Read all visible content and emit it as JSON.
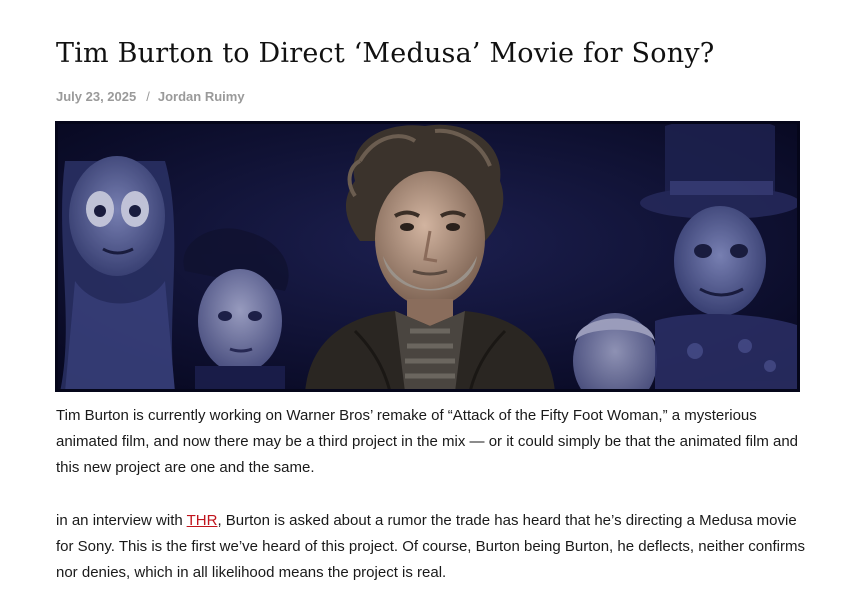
{
  "article": {
    "title": "Tim Burton to Direct ‘Medusa’ Movie for Sony?",
    "date": "July 23, 2025",
    "separator": "/",
    "author": "Jordan Ruimy",
    "hero_image": {
      "icon": "portrait-collage-image",
      "background_color": "#0b0c2a"
    },
    "paragraph1": "Tim Burton is currently working on Warner Bros’ remake of “Attack of the Fifty Foot Woman,” a mysterious animated film, and now there may be a third project in the mix — or it could simply be that the animated film and this new project are one and the same.",
    "paragraph2": {
      "lead": "in an interview with ",
      "link_text": "THR",
      "rest": ", Burton is asked about a rumor the trade has heard that he’s directing a Medusa movie for Sony. This is the first we’ve heard of this project. Of course, Burton being Burton, he deflects, neither confirms nor denies, which in all likelihood means the project is real."
    },
    "link_color": "#c0141c"
  }
}
